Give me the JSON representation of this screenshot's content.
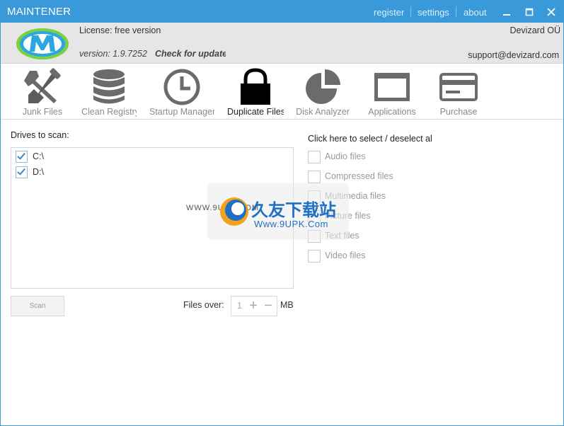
{
  "window": {
    "title": "MAINTENER",
    "links": [
      "register",
      "settings",
      "about"
    ],
    "controls": [
      "minimize",
      "maximize",
      "close"
    ]
  },
  "info": {
    "license": "License: free version",
    "version": "version: 1.9.7252",
    "check_updates": "Check for updates",
    "company": "Devizard OÜ",
    "support": "support@devizard.com"
  },
  "toolbar": {
    "items": [
      {
        "label": "Junk Files",
        "icon": "tools-icon",
        "active": false
      },
      {
        "label": "Clean Registry",
        "icon": "database-icon",
        "active": false
      },
      {
        "label": "Startup Manager",
        "icon": "clock-icon",
        "active": false
      },
      {
        "label": "Duplicate Files",
        "icon": "lock-icon",
        "active": true
      },
      {
        "label": "Disk Analyzer",
        "icon": "pie-chart-icon",
        "active": false
      },
      {
        "label": "Applications",
        "icon": "window-icon",
        "active": false
      },
      {
        "label": "Purchase",
        "icon": "credit-card-icon",
        "active": false
      }
    ]
  },
  "drives": {
    "label": "Drives to scan:",
    "items": [
      {
        "name": "C:\\",
        "checked": true
      },
      {
        "name": "D:\\",
        "checked": true
      }
    ]
  },
  "scan": {
    "button": "Scan",
    "files_over_label": "Files over:",
    "value": "1",
    "unit": "MB"
  },
  "filetypes": {
    "select_all": "Click here to select / deselect all",
    "items": [
      {
        "label": "Audio files",
        "checked": false
      },
      {
        "label": "Compressed files",
        "checked": false
      },
      {
        "label": "Multimedia files",
        "checked": false
      },
      {
        "label": "Picture files",
        "checked": false
      },
      {
        "label": "Text files",
        "checked": false
      },
      {
        "label": "Video files",
        "checked": false
      }
    ]
  },
  "watermark": {
    "site_small": "WWW.9UPK.COM",
    "brand_cn": "久友下载站",
    "site_url": "Www.9UPK.Com"
  },
  "colors": {
    "accent": "#3a9ad9",
    "info_bar": "#e6e6e6",
    "checkbox_check": "#3a8ad0"
  }
}
